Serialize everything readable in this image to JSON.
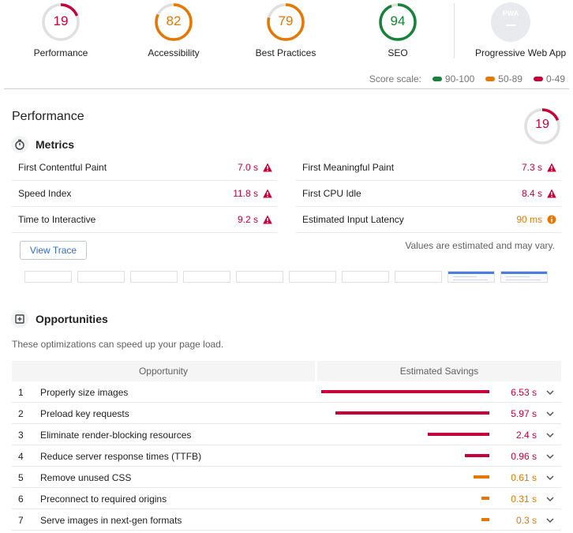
{
  "categories": [
    {
      "score": "19",
      "label": "Performance",
      "fraction": 0.19,
      "color": "#c7003a"
    },
    {
      "score": "82",
      "label": "Accessibility",
      "fraction": 0.82,
      "color": "#e67700"
    },
    {
      "score": "79",
      "label": "Best Practices",
      "fraction": 0.79,
      "color": "#e67700"
    },
    {
      "score": "94",
      "label": "SEO",
      "fraction": 0.94,
      "color": "#178239"
    },
    {
      "badge_text": "PWA",
      "label": "Progressive Web App"
    }
  ],
  "score_scale": {
    "label": "Score scale:",
    "ranges": [
      {
        "text": "90-100",
        "color": "#178239"
      },
      {
        "text": "50-89",
        "color": "#e67700"
      },
      {
        "text": "0-49",
        "color": "#c7003a"
      }
    ]
  },
  "performance": {
    "title": "Performance",
    "score": "19",
    "fraction": 0.19,
    "metrics_title": "Metrics",
    "metrics": [
      {
        "name": "First Contentful Paint",
        "value": "7.0 s",
        "status": "fail"
      },
      {
        "name": "First Meaningful Paint",
        "value": "7.3 s",
        "status": "fail"
      },
      {
        "name": "Speed Index",
        "value": "11.8 s",
        "status": "fail"
      },
      {
        "name": "First CPU Idle",
        "value": "8.4 s",
        "status": "fail"
      },
      {
        "name": "Time to Interactive",
        "value": "9.2 s",
        "status": "fail"
      },
      {
        "name": "Estimated Input Latency",
        "value": "90 ms",
        "status": "average"
      }
    ],
    "view_trace_label": "View Trace",
    "estimate_note": "Values are estimated and may vary.",
    "opportunities_title": "Opportunities",
    "opportunities_desc": "These optimizations can speed up your page load.",
    "table_headers": {
      "opportunity": "Opportunity",
      "savings": "Estimated Savings"
    },
    "opportunities": [
      {
        "index": "1",
        "title": "Properly size images",
        "savings": "6.53 s",
        "seconds": 6.53,
        "status": "fail"
      },
      {
        "index": "2",
        "title": "Preload key requests",
        "savings": "5.97 s",
        "seconds": 5.97,
        "status": "fail"
      },
      {
        "index": "3",
        "title": "Eliminate render-blocking resources",
        "savings": "2.4 s",
        "seconds": 2.4,
        "status": "fail"
      },
      {
        "index": "4",
        "title": "Reduce server response times (TTFB)",
        "savings": "0.96 s",
        "seconds": 0.96,
        "status": "fail"
      },
      {
        "index": "5",
        "title": "Remove unused CSS",
        "savings": "0.61 s",
        "seconds": 0.61,
        "status": "average"
      },
      {
        "index": "6",
        "title": "Preconnect to required origins",
        "savings": "0.31 s",
        "seconds": 0.31,
        "status": "average"
      },
      {
        "index": "7",
        "title": "Serve images in next-gen formats",
        "savings": "0.3 s",
        "seconds": 0.3,
        "status": "average"
      }
    ]
  }
}
